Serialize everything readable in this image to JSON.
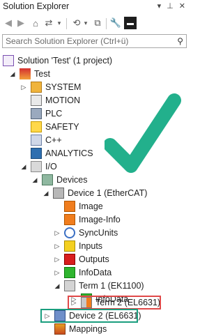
{
  "window": {
    "title": "Solution Explorer",
    "pin": "↓ □ ×"
  },
  "search": {
    "placeholder": "Search Solution Explorer (Ctrl+ü)"
  },
  "tree": {
    "solution": "Solution 'Test' (1 project)",
    "project": "Test",
    "system": "SYSTEM",
    "motion": "MOTION",
    "plc": "PLC",
    "safety": "SAFETY",
    "cpp": "C++",
    "analytics": "ANALYTICS",
    "io": "I/O",
    "devices": "Devices",
    "device1": "Device 1 (EtherCAT)",
    "image": "Image",
    "image_info": "Image-Info",
    "syncunits": "SyncUnits",
    "inputs": "Inputs",
    "outputs": "Outputs",
    "infodata": "InfoData",
    "term1": "Term 1 (EK1100)",
    "term1_infodata": "InfoData",
    "term2": "Term 2 (EL6631)",
    "device2": "Device 2 (EL6631)",
    "mappings": "Mappings"
  },
  "colors": {
    "highlight_red": "#e04848",
    "highlight_green": "#1a9e7e",
    "checkmark": "#22b08c"
  }
}
